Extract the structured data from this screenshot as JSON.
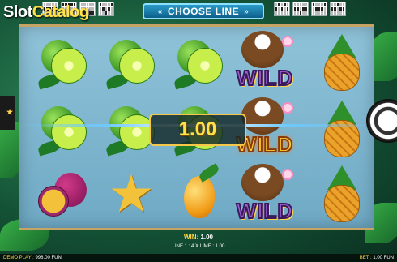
{
  "watermark": {
    "brand": "Slot",
    "brand2": "Catalog"
  },
  "header": {
    "choose_line_label": "CHOOSE LINE"
  },
  "reels": [
    [
      "lime",
      "lime",
      "passion-fruit"
    ],
    [
      "lime",
      "lime",
      "star-fruit"
    ],
    [
      "lime",
      "lime",
      "mango"
    ],
    [
      "wild",
      "wild",
      "wild"
    ],
    [
      "pineapple",
      "pineapple",
      "pineapple"
    ]
  ],
  "symbols": {
    "wild_text": "WILD"
  },
  "win_overlay": {
    "amount": "1.00"
  },
  "win_display": {
    "label": "WIN:",
    "value": "1.00"
  },
  "line_info": "LINE 1 : 4 X LIME : 1.00",
  "status": {
    "demo_label": "DEMO PLAY :",
    "demo_value": "998.00 FUN",
    "bet_label": "BET :",
    "bet_value": "1.00 FUN"
  },
  "colors": {
    "accent_gold": "#ffd84a",
    "choose_line_blue": "#2a9cc9",
    "wild_purple": "#9b5fd1"
  }
}
